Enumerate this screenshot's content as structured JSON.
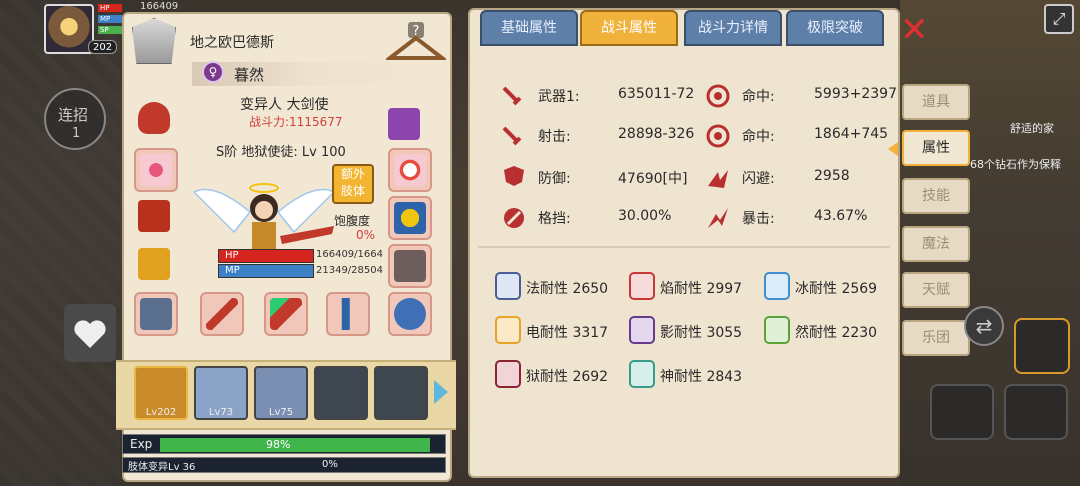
{
  "hud": {
    "avatar_level": "202",
    "top_hp_text": "166409",
    "combo_label": "连招",
    "combo_count": "1",
    "right_hint_1": "舒适的家",
    "right_hint_2": "68个钻石作为保释"
  },
  "character": {
    "location_title": "地之欧巴德斯",
    "name": "暮然",
    "name_icon": "gender-symbol",
    "class": "变异人 大剑使",
    "combat_power": "战斗力:1115677",
    "rank_line": "S阶 地狱使徒: Lv 100",
    "extra_limb_button": "额外\n肢体",
    "satiety_label": "饱腹度",
    "satiety_value": "0%",
    "hp_label": "HP",
    "mp_label": "MP",
    "hp_value": "166409/1664",
    "mp_value": "21349/28504"
  },
  "party": {
    "members": [
      {
        "level": "Lv202",
        "selected": true
      },
      {
        "level": "Lv73",
        "selected": false
      },
      {
        "level": "Lv75",
        "selected": false
      },
      {
        "level": "",
        "selected": false
      },
      {
        "level": "",
        "selected": false
      }
    ]
  },
  "exp": {
    "label": "Exp",
    "percent_text": "98%",
    "fill": 0.98,
    "limb_label": "肢体变异Lv 36",
    "limb_percent": "0%"
  },
  "tabs": [
    {
      "label": "基础属性",
      "active": false
    },
    {
      "label": "战斗属性",
      "active": true
    },
    {
      "label": "战斗力详情",
      "active": false
    },
    {
      "label": "极限突破",
      "active": false
    }
  ],
  "combat_stats": [
    {
      "label": "武器1:",
      "value": "635011-72",
      "icon": "sword-icon"
    },
    {
      "label": "命中:",
      "value": "5993+2397",
      "icon": "target-icon"
    },
    {
      "label": "射击:",
      "value": "28898-326",
      "icon": "sword-icon"
    },
    {
      "label": "命中:",
      "value": "1864+745",
      "icon": "target-icon"
    },
    {
      "label": "防御:",
      "value": "47690[中]",
      "icon": "shield-icon"
    },
    {
      "label": "闪避:",
      "value": "2958",
      "icon": "dodge-icon"
    },
    {
      "label": "格挡:",
      "value": "30.00%",
      "icon": "block-icon"
    },
    {
      "label": "暴击:",
      "value": "43.67%",
      "icon": "critical-icon"
    }
  ],
  "resistances": [
    {
      "label": "法耐性 2650",
      "color": "#4b5e9a"
    },
    {
      "label": "焰耐性 2997",
      "color": "#c7383a"
    },
    {
      "label": "冰耐性 2569",
      "color": "#3f8fd0"
    },
    {
      "label": "电耐性 3317",
      "color": "#e7a228"
    },
    {
      "label": "影耐性 3055",
      "color": "#6a3b8c"
    },
    {
      "label": "然耐性 2230",
      "color": "#5aa33a"
    },
    {
      "label": "狱耐性 2692",
      "color": "#8c2434"
    },
    {
      "label": "神耐性 2843",
      "color": "#3a9a8c"
    }
  ],
  "side_menu": [
    {
      "label": "道具",
      "active": false
    },
    {
      "label": "属性",
      "active": true
    },
    {
      "label": "技能",
      "active": false
    },
    {
      "label": "魔法",
      "active": false
    },
    {
      "label": "天赋",
      "active": false
    },
    {
      "label": "乐团",
      "active": false
    }
  ],
  "colors": {
    "accent_tab": "#f0b23a",
    "tab_blue": "#5e7fa8",
    "power_red": "#d24040"
  }
}
